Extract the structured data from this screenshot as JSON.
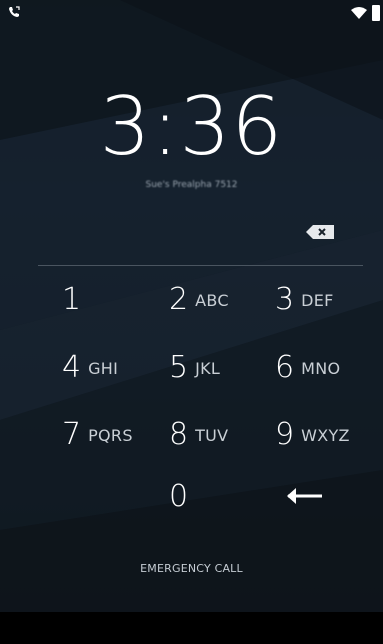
{
  "status_bar": {
    "left_icon": "voicemail-call-icon",
    "wifi_icon": "wifi-icon",
    "battery_icon": "battery-icon"
  },
  "lock": {
    "time": "3:36",
    "owner_info": "Sue's Prealpha 7512"
  },
  "pin_entry": {
    "backspace_icon": "backspace-icon"
  },
  "keypad": {
    "keys": [
      {
        "digit": "1",
        "letters": ""
      },
      {
        "digit": "2",
        "letters": "ABC"
      },
      {
        "digit": "3",
        "letters": "DEF"
      },
      {
        "digit": "4",
        "letters": "GHI"
      },
      {
        "digit": "5",
        "letters": "JKL"
      },
      {
        "digit": "6",
        "letters": "MNO"
      },
      {
        "digit": "7",
        "letters": "PQRS"
      },
      {
        "digit": "8",
        "letters": "TUV"
      },
      {
        "digit": "9",
        "letters": "WXYZ"
      },
      {
        "digit": "0",
        "letters": ""
      }
    ],
    "enter_icon": "enter-arrow-icon"
  },
  "emergency_label": "EMERGENCY CALL",
  "colors": {
    "background": "#111a23",
    "text": "#ffffff",
    "subtext": "#c9cfd5",
    "divider": "#4a5560"
  }
}
